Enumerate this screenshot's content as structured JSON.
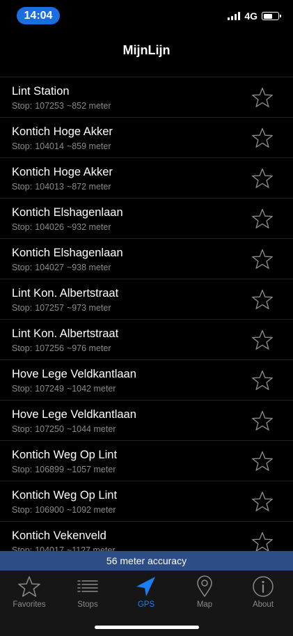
{
  "status": {
    "time": "14:04",
    "network": "4G"
  },
  "nav": {
    "title": "MijnLijn"
  },
  "stop_prefix": "Stop:",
  "stops": [
    {
      "name": "Lint Station",
      "stop_id": "107253",
      "distance": "~852 meter"
    },
    {
      "name": "Kontich Hoge Akker",
      "stop_id": "104014",
      "distance": "~859 meter"
    },
    {
      "name": "Kontich Hoge Akker",
      "stop_id": "104013",
      "distance": "~872 meter"
    },
    {
      "name": "Kontich Elshagenlaan",
      "stop_id": "104026",
      "distance": "~932 meter"
    },
    {
      "name": "Kontich Elshagenlaan",
      "stop_id": "104027",
      "distance": "~938 meter"
    },
    {
      "name": "Lint Kon. Albertstraat",
      "stop_id": "107257",
      "distance": "~973 meter"
    },
    {
      "name": "Lint Kon. Albertstraat",
      "stop_id": "107256",
      "distance": "~976 meter"
    },
    {
      "name": "Hove Lege Veldkantlaan",
      "stop_id": "107249",
      "distance": "~1042 meter"
    },
    {
      "name": "Hove Lege Veldkantlaan",
      "stop_id": "107250",
      "distance": "~1044 meter"
    },
    {
      "name": "Kontich Weg Op Lint",
      "stop_id": "106899",
      "distance": "~1057 meter"
    },
    {
      "name": "Kontich Weg Op Lint",
      "stop_id": "106900",
      "distance": "~1092 meter"
    },
    {
      "name": "Kontich Vekenveld",
      "stop_id": "104017",
      "distance": "~1127 meter"
    }
  ],
  "accuracy": {
    "text": "56 meter accuracy"
  },
  "tabs": [
    {
      "label": "Favorites",
      "icon": "star-icon"
    },
    {
      "label": "Stops",
      "icon": "list-icon"
    },
    {
      "label": "GPS",
      "icon": "location-arrow-icon",
      "active": true
    },
    {
      "label": "Map",
      "icon": "map-pin-icon"
    },
    {
      "label": "About",
      "icon": "info-icon"
    }
  ],
  "colors": {
    "background": "#000000",
    "time_pill": "#1a6fe0",
    "accuracy_banner": "#2c4d86",
    "tab_active": "#1a7ff5",
    "tab_inactive": "#8a8a8e",
    "subtitle_text": "#8a8a8e"
  }
}
